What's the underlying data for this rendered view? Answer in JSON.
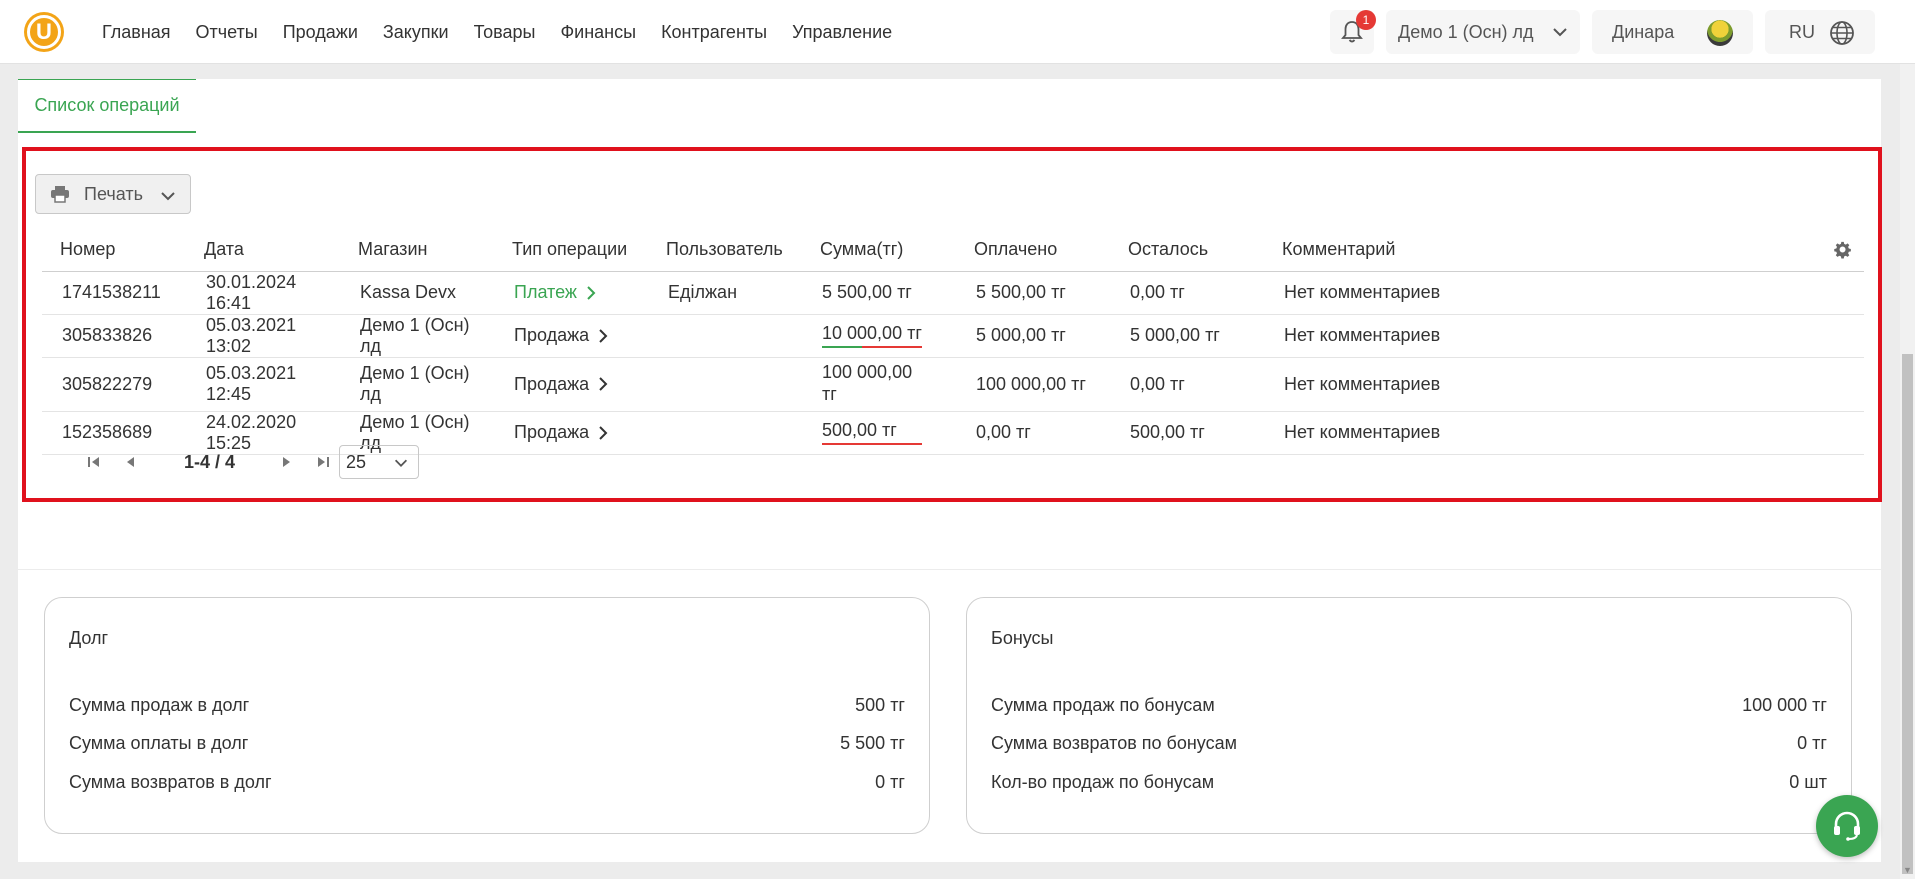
{
  "header": {
    "logo_letter": "U",
    "nav": [
      "Главная",
      "Отчеты",
      "Продажи",
      "Закупки",
      "Товары",
      "Финансы",
      "Контрагенты",
      "Управление"
    ],
    "notification_count": "1",
    "store_name": "Демо 1 (Осн) лд",
    "user_name": "Динара",
    "language": "RU"
  },
  "tabs": {
    "operations_list": "Список операций"
  },
  "toolbar": {
    "print_label": "Печать"
  },
  "table": {
    "columns": [
      "Номер",
      "Дата",
      "Магазин",
      "Тип операции",
      "Пользователь",
      "Сумма(тг)",
      "Оплачено",
      "Осталось",
      "Комментарий"
    ],
    "rows": [
      {
        "number": "1741538211",
        "date": "30.01.2024 16:41",
        "store": "Kassa Devx",
        "type": "Платеж",
        "user": "Еділжан",
        "sum": "5 500,00 тг",
        "paid": "5 500,00 тг",
        "remaining": "0,00 тг",
        "comment": "Нет комментариев"
      },
      {
        "number": "305833826",
        "date": "05.03.2021 13:02",
        "store": "Демо 1 (Осн) лд",
        "type": "Продажа",
        "user": "",
        "sum": "10 000,00 тг",
        "paid": "5 000,00 тг",
        "remaining": "5 000,00 тг",
        "comment": "Нет комментариев"
      },
      {
        "number": "305822279",
        "date": "05.03.2021 12:45",
        "store": "Демо 1 (Осн) лд",
        "type": "Продажа",
        "user": "",
        "sum": "100 000,00 тг",
        "paid": "100 000,00 тг",
        "remaining": "0,00 тг",
        "comment": "Нет комментариев"
      },
      {
        "number": "152358689",
        "date": "24.02.2020 15:25",
        "store": "Демо 1 (Осн) лд",
        "type": "Продажа",
        "user": "",
        "sum": "500,00 тг",
        "paid": "0,00 тг",
        "remaining": "500,00 тг",
        "comment": "Нет комментариев"
      }
    ]
  },
  "pagination": {
    "range": "1-4 / 4",
    "per_page": "25"
  },
  "debt": {
    "title": "Долг",
    "rows": [
      {
        "label": "Сумма продаж в долг",
        "value": "500 тг"
      },
      {
        "label": "Сумма оплаты в долг",
        "value": "5 500 тг"
      },
      {
        "label": "Сумма возвратов в долг",
        "value": "0 тг"
      }
    ]
  },
  "bonuses": {
    "title": "Бонусы",
    "rows": [
      {
        "label": "Сумма продаж по бонусам",
        "value": "100 000 тг"
      },
      {
        "label": "Сумма возвратов по бонусам",
        "value": "0 тг"
      },
      {
        "label": "Кол-во продаж по бонусам",
        "value": "0 шт"
      }
    ]
  },
  "colors": {
    "accent": "#3aa552",
    "highlight": "#e0111d",
    "logo": "#f3a417"
  }
}
